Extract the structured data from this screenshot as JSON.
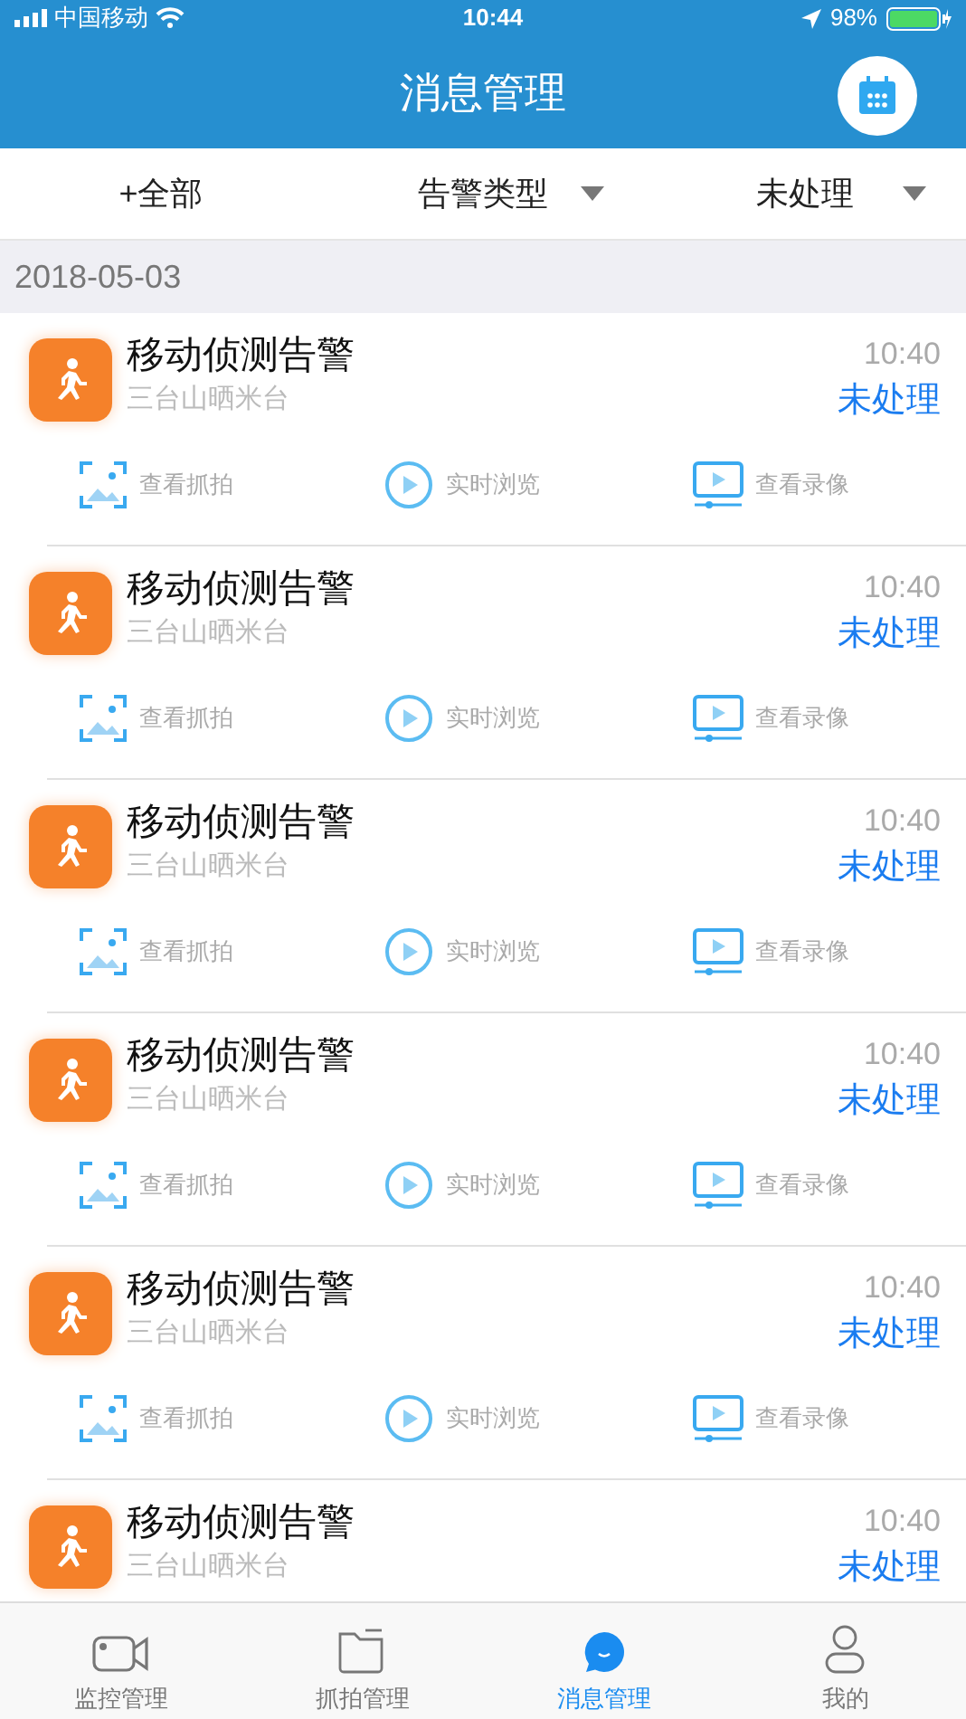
{
  "status_bar": {
    "carrier": "中国移动",
    "time": "10:44",
    "battery": "98%"
  },
  "header": {
    "title": "消息管理"
  },
  "filters": [
    {
      "kind": "plain",
      "label": "+全部"
    },
    {
      "kind": "dropdown",
      "label": "告警类型"
    },
    {
      "kind": "dropdown",
      "label": "未处理"
    }
  ],
  "date": "2018-05-03",
  "alarms": [
    {
      "title": "移动侦测告警",
      "location": "三台山晒米台",
      "time": "10:40",
      "status": "未处理",
      "actions": [
        {
          "kind": "snapshot",
          "label": "查看抓拍"
        },
        {
          "kind": "live",
          "label": "实时浏览"
        },
        {
          "kind": "recording",
          "label": "查看录像"
        }
      ]
    },
    {
      "title": "移动侦测告警",
      "location": "三台山晒米台",
      "time": "10:40",
      "status": "未处理",
      "actions": [
        {
          "kind": "snapshot",
          "label": "查看抓拍"
        },
        {
          "kind": "live",
          "label": "实时浏览"
        },
        {
          "kind": "recording",
          "label": "查看录像"
        }
      ]
    },
    {
      "title": "移动侦测告警",
      "location": "三台山晒米台",
      "time": "10:40",
      "status": "未处理",
      "actions": [
        {
          "kind": "snapshot",
          "label": "查看抓拍"
        },
        {
          "kind": "live",
          "label": "实时浏览"
        },
        {
          "kind": "recording",
          "label": "查看录像"
        }
      ]
    },
    {
      "title": "移动侦测告警",
      "location": "三台山晒米台",
      "time": "10:40",
      "status": "未处理",
      "actions": [
        {
          "kind": "snapshot",
          "label": "查看抓拍"
        },
        {
          "kind": "live",
          "label": "实时浏览"
        },
        {
          "kind": "recording",
          "label": "查看录像"
        }
      ]
    },
    {
      "title": "移动侦测告警",
      "location": "三台山晒米台",
      "time": "10:40",
      "status": "未处理",
      "actions": [
        {
          "kind": "snapshot",
          "label": "查看抓拍"
        },
        {
          "kind": "live",
          "label": "实时浏览"
        },
        {
          "kind": "recording",
          "label": "查看录像"
        }
      ]
    },
    {
      "title": "移动侦测告警",
      "location": "三台山晒米台",
      "time": "10:40",
      "status": "未处理"
    }
  ],
  "tab_bar": [
    {
      "kind": "camera",
      "label": "监控管理",
      "selected": false
    },
    {
      "kind": "folder",
      "label": "抓拍管理",
      "selected": false
    },
    {
      "kind": "chat",
      "label": "消息管理",
      "selected": true
    },
    {
      "kind": "person",
      "label": "我的",
      "selected": false
    }
  ]
}
